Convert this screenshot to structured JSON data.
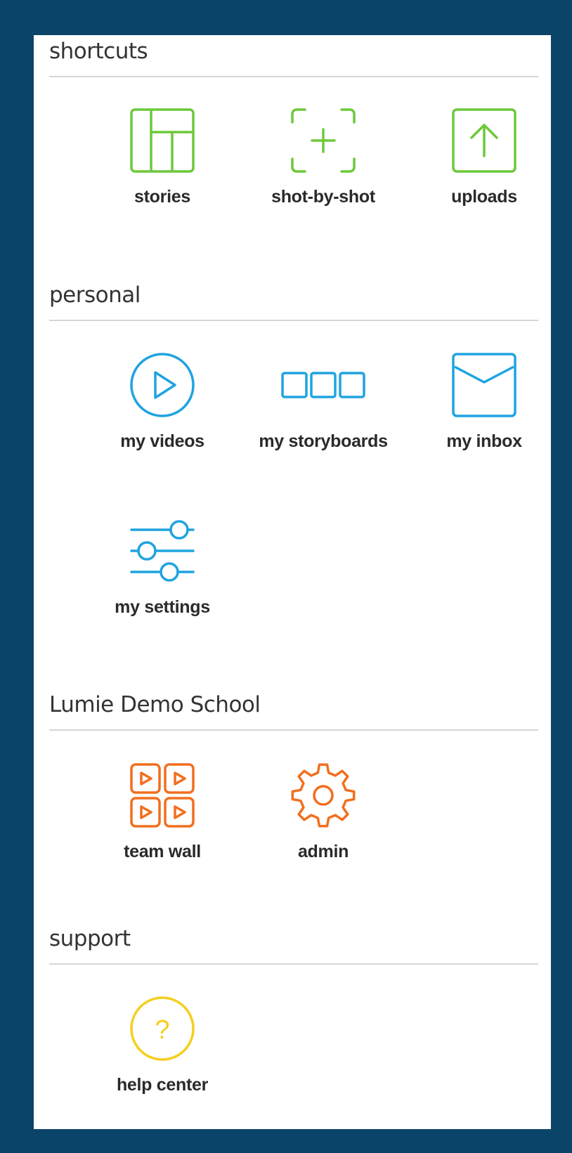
{
  "sections": [
    {
      "title": "shortcuts",
      "items": [
        {
          "label": "stories",
          "icon": "stories-icon"
        },
        {
          "label": "shot-by-shot",
          "icon": "shot-by-shot-icon"
        },
        {
          "label": "uploads",
          "icon": "upload-icon"
        }
      ]
    },
    {
      "title": "personal",
      "items": [
        {
          "label": "my videos",
          "icon": "play-icon"
        },
        {
          "label": "my storyboards",
          "icon": "storyboard-icon"
        },
        {
          "label": "my inbox",
          "icon": "inbox-icon"
        },
        {
          "label": "my settings",
          "icon": "sliders-icon"
        }
      ]
    },
    {
      "title": "Lumie Demo School",
      "items": [
        {
          "label": "team wall",
          "icon": "team-wall-icon"
        },
        {
          "label": "admin",
          "icon": "gear-icon"
        }
      ]
    },
    {
      "title": "support",
      "items": [
        {
          "label": "help center",
          "icon": "help-icon"
        }
      ]
    }
  ],
  "colors": {
    "background": "#0a4468",
    "shortcuts": "#6cc93a",
    "personal": "#1fa3e0",
    "school": "#f26f1e",
    "support": "#f5cf1f"
  }
}
